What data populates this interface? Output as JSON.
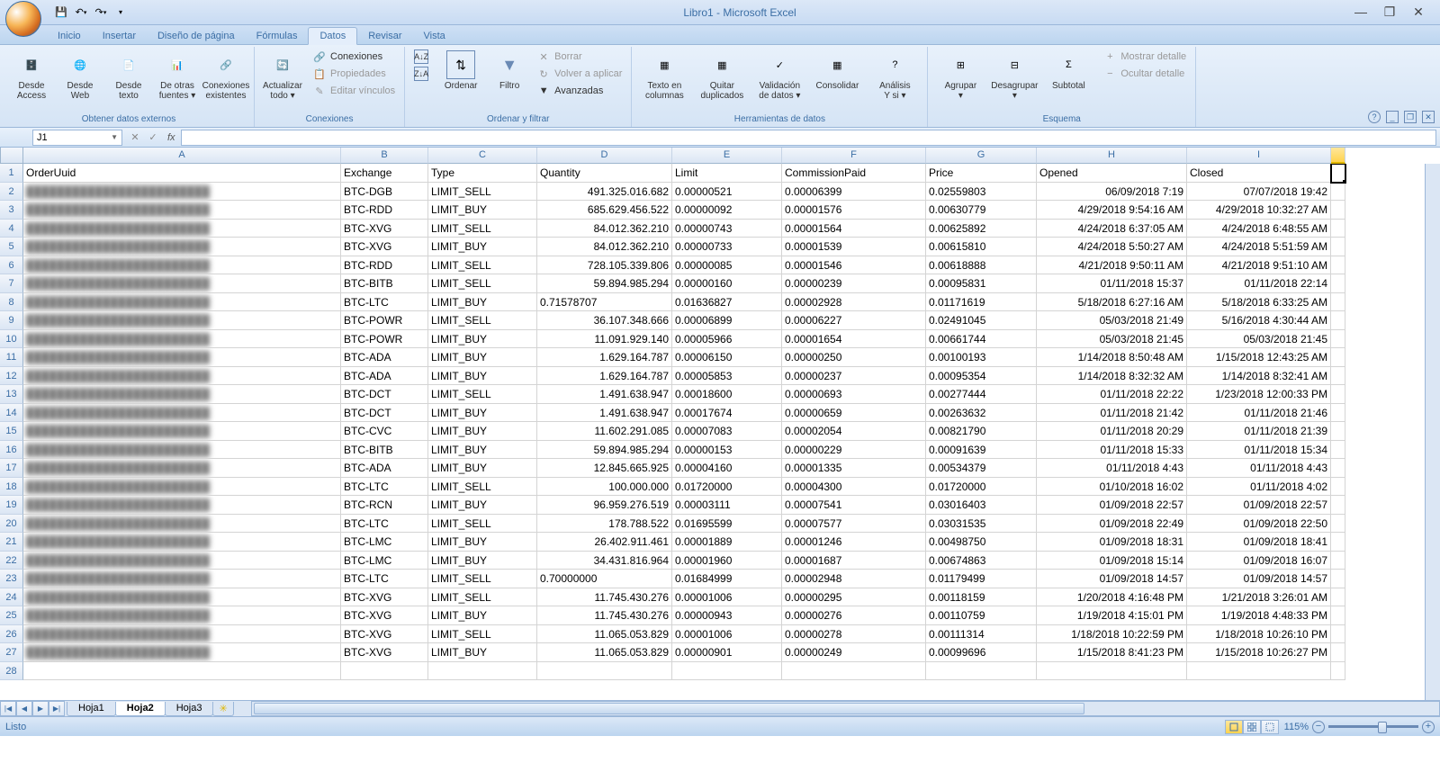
{
  "title": "Libro1 - Microsoft Excel",
  "qat": {
    "save": "💾",
    "undo": "↶",
    "redo": "↷",
    "drop": "▾"
  },
  "win": {
    "min": "—",
    "max": "❐",
    "close": "✕"
  },
  "tabs": [
    "Inicio",
    "Insertar",
    "Diseño de página",
    "Fórmulas",
    "Datos",
    "Revisar",
    "Vista"
  ],
  "active_tab": 4,
  "ribbon": {
    "g1": {
      "label": "Obtener datos externos",
      "btns": [
        {
          "l": "Desde\nAccess",
          "i": "🗄️"
        },
        {
          "l": "Desde\nWeb",
          "i": "🌐"
        },
        {
          "l": "Desde\ntexto",
          "i": "📄"
        },
        {
          "l": "De otras\nfuentes ▾",
          "i": "📊"
        },
        {
          "l": "Conexiones\nexistentes",
          "i": "🔗"
        }
      ]
    },
    "g2": {
      "label": "Conexiones",
      "main": {
        "l": "Actualizar\ntodo ▾",
        "i": "🔄"
      },
      "sub": [
        {
          "l": "Conexiones",
          "i": "🔗"
        },
        {
          "l": "Propiedades",
          "i": "📋",
          "d": true
        },
        {
          "l": "Editar vínculos",
          "i": "✎",
          "d": true
        }
      ]
    },
    "g3": {
      "label": "Ordenar y filtrar",
      "az": {
        "l": "A↓Z"
      },
      "za": {
        "l": "Z↓A"
      },
      "ordenar": {
        "l": "Ordenar",
        "i": "⇅"
      },
      "filtro": {
        "l": "Filtro",
        "i": "▼"
      },
      "sub": [
        {
          "l": "Borrar",
          "i": "✕",
          "d": true
        },
        {
          "l": "Volver a aplicar",
          "i": "↻",
          "d": true
        },
        {
          "l": "Avanzadas",
          "i": "▼"
        }
      ]
    },
    "g4": {
      "label": "Herramientas de datos",
      "btns": [
        {
          "l": "Texto en\ncolumnas",
          "i": "▦"
        },
        {
          "l": "Quitar\nduplicados",
          "i": "▦"
        },
        {
          "l": "Validación\nde datos ▾",
          "i": "✓"
        },
        {
          "l": "Consolidar",
          "i": "▦"
        },
        {
          "l": "Análisis\nY si ▾",
          "i": "?"
        }
      ]
    },
    "g5": {
      "label": "Esquema",
      "btns": [
        {
          "l": "Agrupar\n▾",
          "i": "⊞"
        },
        {
          "l": "Desagrupar\n▾",
          "i": "⊟"
        },
        {
          "l": "Subtotal",
          "i": "Σ"
        }
      ],
      "sub": [
        {
          "l": "Mostrar detalle",
          "i": "+",
          "d": true
        },
        {
          "l": "Ocultar detalle",
          "i": "−",
          "d": true
        }
      ]
    }
  },
  "namebox": "J1",
  "fx": "fx",
  "columns": [
    "A",
    "B",
    "C",
    "D",
    "E",
    "F",
    "G",
    "H",
    "I"
  ],
  "headers": [
    "OrderUuid",
    "Exchange",
    "Type",
    "Quantity",
    "Limit",
    "CommissionPaid",
    "Price",
    "Opened",
    "Closed"
  ],
  "rows": [
    {
      "n": 2,
      "a": "████████████████████████",
      "b": "BTC-DGB",
      "c": "LIMIT_SELL",
      "d": "491.325.016.682",
      "e": "0.00000521",
      "f": "0.00006399",
      "g": "0.02559803",
      "h": "06/09/2018 7:19",
      "i": "07/07/2018 19:42"
    },
    {
      "n": 3,
      "a": "████████████████████████",
      "b": "BTC-RDD",
      "c": "LIMIT_BUY",
      "d": "685.629.456.522",
      "e": "0.00000092",
      "f": "0.00001576",
      "g": "0.00630779",
      "h": "4/29/2018 9:54:16 AM",
      "i": "4/29/2018 10:32:27 AM"
    },
    {
      "n": 4,
      "a": "████████████████████████",
      "b": "BTC-XVG",
      "c": "LIMIT_SELL",
      "d": "84.012.362.210",
      "e": "0.00000743",
      "f": "0.00001564",
      "g": "0.00625892",
      "h": "4/24/2018 6:37:05 AM",
      "i": "4/24/2018 6:48:55 AM"
    },
    {
      "n": 5,
      "a": "████████████████████████",
      "b": "BTC-XVG",
      "c": "LIMIT_BUY",
      "d": "84.012.362.210",
      "e": "0.00000733",
      "f": "0.00001539",
      "g": "0.00615810",
      "h": "4/24/2018 5:50:27 AM",
      "i": "4/24/2018 5:51:59 AM"
    },
    {
      "n": 6,
      "a": "████████████████████████",
      "b": "BTC-RDD",
      "c": "LIMIT_SELL",
      "d": "728.105.339.806",
      "e": "0.00000085",
      "f": "0.00001546",
      "g": "0.00618888",
      "h": "4/21/2018 9:50:11 AM",
      "i": "4/21/2018 9:51:10 AM"
    },
    {
      "n": 7,
      "a": "████████████████████████",
      "b": "BTC-BITB",
      "c": "LIMIT_SELL",
      "d": "59.894.985.294",
      "e": "0.00000160",
      "f": "0.00000239",
      "g": "0.00095831",
      "h": "01/11/2018 15:37",
      "i": "01/11/2018 22:14"
    },
    {
      "n": 8,
      "a": "████████████████████████",
      "b": "BTC-LTC",
      "c": "LIMIT_BUY",
      "d": "0.71578707",
      "e": "0.01636827",
      "f": "0.00002928",
      "g": "0.01171619",
      "h": "5/18/2018 6:27:16 AM",
      "i": "5/18/2018 6:33:25 AM"
    },
    {
      "n": 9,
      "a": "████████████████████████",
      "b": "BTC-POWR",
      "c": "LIMIT_SELL",
      "d": "36.107.348.666",
      "e": "0.00006899",
      "f": "0.00006227",
      "g": "0.02491045",
      "h": "05/03/2018 21:49",
      "i": "5/16/2018 4:30:44 AM"
    },
    {
      "n": 10,
      "a": "████████████████████████",
      "b": "BTC-POWR",
      "c": "LIMIT_BUY",
      "d": "11.091.929.140",
      "e": "0.00005966",
      "f": "0.00001654",
      "g": "0.00661744",
      "h": "05/03/2018 21:45",
      "i": "05/03/2018 21:45"
    },
    {
      "n": 11,
      "a": "████████████████████████",
      "b": "BTC-ADA",
      "c": "LIMIT_BUY",
      "d": "1.629.164.787",
      "e": "0.00006150",
      "f": "0.00000250",
      "g": "0.00100193",
      "h": "1/14/2018 8:50:48 AM",
      "i": "1/15/2018 12:43:25 AM"
    },
    {
      "n": 12,
      "a": "████████████████████████",
      "b": "BTC-ADA",
      "c": "LIMIT_BUY",
      "d": "1.629.164.787",
      "e": "0.00005853",
      "f": "0.00000237",
      "g": "0.00095354",
      "h": "1/14/2018 8:32:32 AM",
      "i": "1/14/2018 8:32:41 AM"
    },
    {
      "n": 13,
      "a": "████████████████████████",
      "b": "BTC-DCT",
      "c": "LIMIT_SELL",
      "d": "1.491.638.947",
      "e": "0.00018600",
      "f": "0.00000693",
      "g": "0.00277444",
      "h": "01/11/2018 22:22",
      "i": "1/23/2018 12:00:33 PM"
    },
    {
      "n": 14,
      "a": "████████████████████████",
      "b": "BTC-DCT",
      "c": "LIMIT_BUY",
      "d": "1.491.638.947",
      "e": "0.00017674",
      "f": "0.00000659",
      "g": "0.00263632",
      "h": "01/11/2018 21:42",
      "i": "01/11/2018 21:46"
    },
    {
      "n": 15,
      "a": "████████████████████████",
      "b": "BTC-CVC",
      "c": "LIMIT_BUY",
      "d": "11.602.291.085",
      "e": "0.00007083",
      "f": "0.00002054",
      "g": "0.00821790",
      "h": "01/11/2018 20:29",
      "i": "01/11/2018 21:39"
    },
    {
      "n": 16,
      "a": "████████████████████████",
      "b": "BTC-BITB",
      "c": "LIMIT_BUY",
      "d": "59.894.985.294",
      "e": "0.00000153",
      "f": "0.00000229",
      "g": "0.00091639",
      "h": "01/11/2018 15:33",
      "i": "01/11/2018 15:34"
    },
    {
      "n": 17,
      "a": "████████████████████████",
      "b": "BTC-ADA",
      "c": "LIMIT_BUY",
      "d": "12.845.665.925",
      "e": "0.00004160",
      "f": "0.00001335",
      "g": "0.00534379",
      "h": "01/11/2018 4:43",
      "i": "01/11/2018 4:43"
    },
    {
      "n": 18,
      "a": "████████████████████████",
      "b": "BTC-LTC",
      "c": "LIMIT_SELL",
      "d": "100.000.000",
      "e": "0.01720000",
      "f": "0.00004300",
      "g": "0.01720000",
      "h": "01/10/2018 16:02",
      "i": "01/11/2018 4:02"
    },
    {
      "n": 19,
      "a": "████████████████████████",
      "b": "BTC-RCN",
      "c": "LIMIT_BUY",
      "d": "96.959.276.519",
      "e": "0.00003111",
      "f": "0.00007541",
      "g": "0.03016403",
      "h": "01/09/2018 22:57",
      "i": "01/09/2018 22:57"
    },
    {
      "n": 20,
      "a": "████████████████████████",
      "b": "BTC-LTC",
      "c": "LIMIT_SELL",
      "d": "178.788.522",
      "e": "0.01695599",
      "f": "0.00007577",
      "g": "0.03031535",
      "h": "01/09/2018 22:49",
      "i": "01/09/2018 22:50"
    },
    {
      "n": 21,
      "a": "████████████████████████",
      "b": "BTC-LMC",
      "c": "LIMIT_BUY",
      "d": "26.402.911.461",
      "e": "0.00001889",
      "f": "0.00001246",
      "g": "0.00498750",
      "h": "01/09/2018 18:31",
      "i": "01/09/2018 18:41"
    },
    {
      "n": 22,
      "a": "████████████████████████",
      "b": "BTC-LMC",
      "c": "LIMIT_BUY",
      "d": "34.431.816.964",
      "e": "0.00001960",
      "f": "0.00001687",
      "g": "0.00674863",
      "h": "01/09/2018 15:14",
      "i": "01/09/2018 16:07"
    },
    {
      "n": 23,
      "a": "████████████████████████",
      "b": "BTC-LTC",
      "c": "LIMIT_SELL",
      "d": "0.70000000",
      "e": "0.01684999",
      "f": "0.00002948",
      "g": "0.01179499",
      "h": "01/09/2018 14:57",
      "i": "01/09/2018 14:57"
    },
    {
      "n": 24,
      "a": "████████████████████████",
      "b": "BTC-XVG",
      "c": "LIMIT_SELL",
      "d": "11.745.430.276",
      "e": "0.00001006",
      "f": "0.00000295",
      "g": "0.00118159",
      "h": "1/20/2018 4:16:48 PM",
      "i": "1/21/2018 3:26:01 AM"
    },
    {
      "n": 25,
      "a": "████████████████████████",
      "b": "BTC-XVG",
      "c": "LIMIT_BUY",
      "d": "11.745.430.276",
      "e": "0.00000943",
      "f": "0.00000276",
      "g": "0.00110759",
      "h": "1/19/2018 4:15:01 PM",
      "i": "1/19/2018 4:48:33 PM"
    },
    {
      "n": 26,
      "a": "████████████████████████",
      "b": "BTC-XVG",
      "c": "LIMIT_SELL",
      "d": "11.065.053.829",
      "e": "0.00001006",
      "f": "0.00000278",
      "g": "0.00111314",
      "h": "1/18/2018 10:22:59 PM",
      "i": "1/18/2018 10:26:10 PM"
    },
    {
      "n": 27,
      "a": "████████████████████████",
      "b": "BTC-XVG",
      "c": "LIMIT_BUY",
      "d": "11.065.053.829",
      "e": "0.00000901",
      "f": "0.00000249",
      "g": "0.00099696",
      "h": "1/15/2018 8:41:23 PM",
      "i": "1/15/2018 10:26:27 PM"
    }
  ],
  "sheets": [
    "Hoja1",
    "Hoja2",
    "Hoja3"
  ],
  "active_sheet": 1,
  "status": "Listo",
  "zoom": "115%"
}
